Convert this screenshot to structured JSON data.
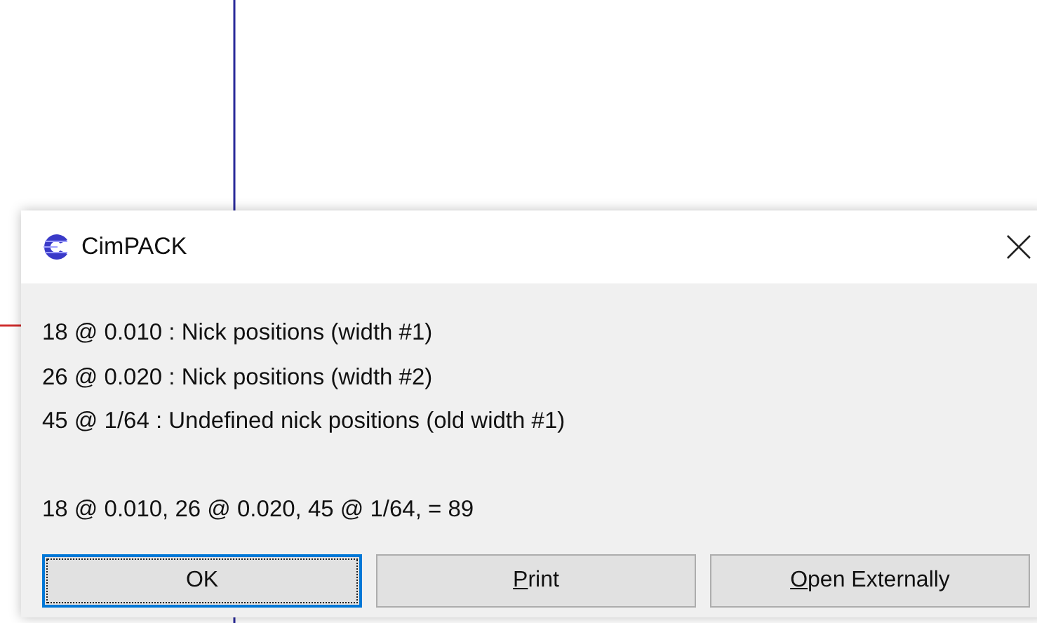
{
  "window": {
    "title": "CimPACK"
  },
  "lines": [
    "18 @ 0.010 : Nick positions (width #1)",
    "26 @ 0.020 : Nick positions (width #2)",
    "45 @ 1/64 : Undefined nick positions (old width #1)"
  ],
  "summary": "18 @ 0.010, 26 @ 0.020, 45 @ 1/64, = 89",
  "buttons": [
    {
      "label": "OK",
      "default": true,
      "mnemonic": false
    },
    {
      "label": "Print",
      "default": false,
      "mnemonic": true
    },
    {
      "label": "Open Externally",
      "default": false,
      "mnemonic": true
    }
  ]
}
